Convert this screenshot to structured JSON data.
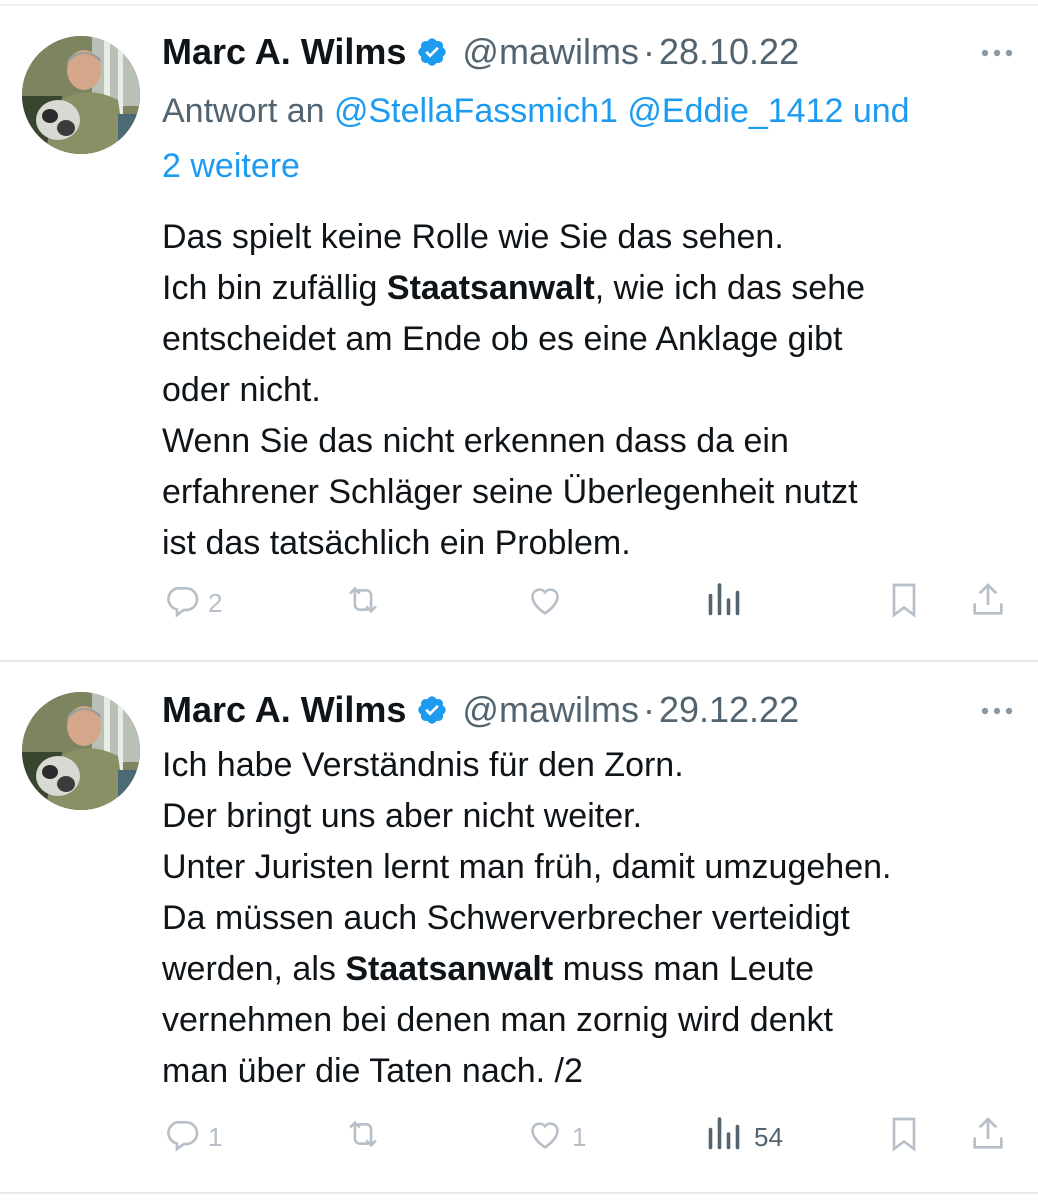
{
  "tweets": [
    {
      "author_name": "Marc A. Wilms",
      "handle": "@mawilms",
      "separator": "·",
      "date": "28.10.22",
      "reply_prefix": "Antwort an",
      "reply_mention_1": "@StellaFassmich1",
      "reply_mention_2": "@Eddie_1412",
      "reply_connector": "und",
      "reply_more": "2 weitere",
      "lines": {
        "l1": "Das spielt keine Rolle wie Sie das sehen.",
        "l2_pre": "Ich bin zufällig ",
        "l2_bold": "Staatsanwalt",
        "l2_post": ", wie ich das sehe",
        "l3": "entscheidet am Ende ob es eine Anklage gibt",
        "l4": "oder nicht.",
        "l5": "Wenn Sie das nicht erkennen dass da ein",
        "l6": "erfahrener Schläger seine Überlegenheit nutzt",
        "l7": "ist das tatsächlich ein Problem."
      },
      "reply_count": "2",
      "like_count": "",
      "views_count": ""
    },
    {
      "author_name": "Marc A. Wilms",
      "handle": "@mawilms",
      "separator": "·",
      "date": "29.12.22",
      "lines": {
        "l1": "Ich habe Verständnis für den Zorn.",
        "l2": "Der bringt uns aber nicht weiter.",
        "l3": "Unter Juristen lernt man früh, damit umzugehen.",
        "l4": "Da müssen auch Schwerverbrecher verteidigt",
        "l5_pre": "werden, als ",
        "l5_bold": "Staatsanwalt",
        "l5_post": " muss man Leute",
        "l6": "vernehmen bei denen man zornig wird denkt",
        "l7": "man über die Taten nach. /2"
      },
      "reply_count": "1",
      "like_count": "1",
      "views_count": "54"
    }
  ],
  "icons": {
    "verified": "verified-badge-icon",
    "more": "more-options-icon",
    "reply": "reply-icon",
    "retweet": "retweet-icon",
    "like": "like-icon",
    "views": "views-icon",
    "bookmark": "bookmark-icon",
    "share": "share-icon"
  },
  "colors": {
    "text": "#0f1419",
    "secondary": "#536471",
    "link": "#1d9bf0",
    "verified": "#1d9bf0",
    "muted_icon": "#b7c0c8"
  }
}
